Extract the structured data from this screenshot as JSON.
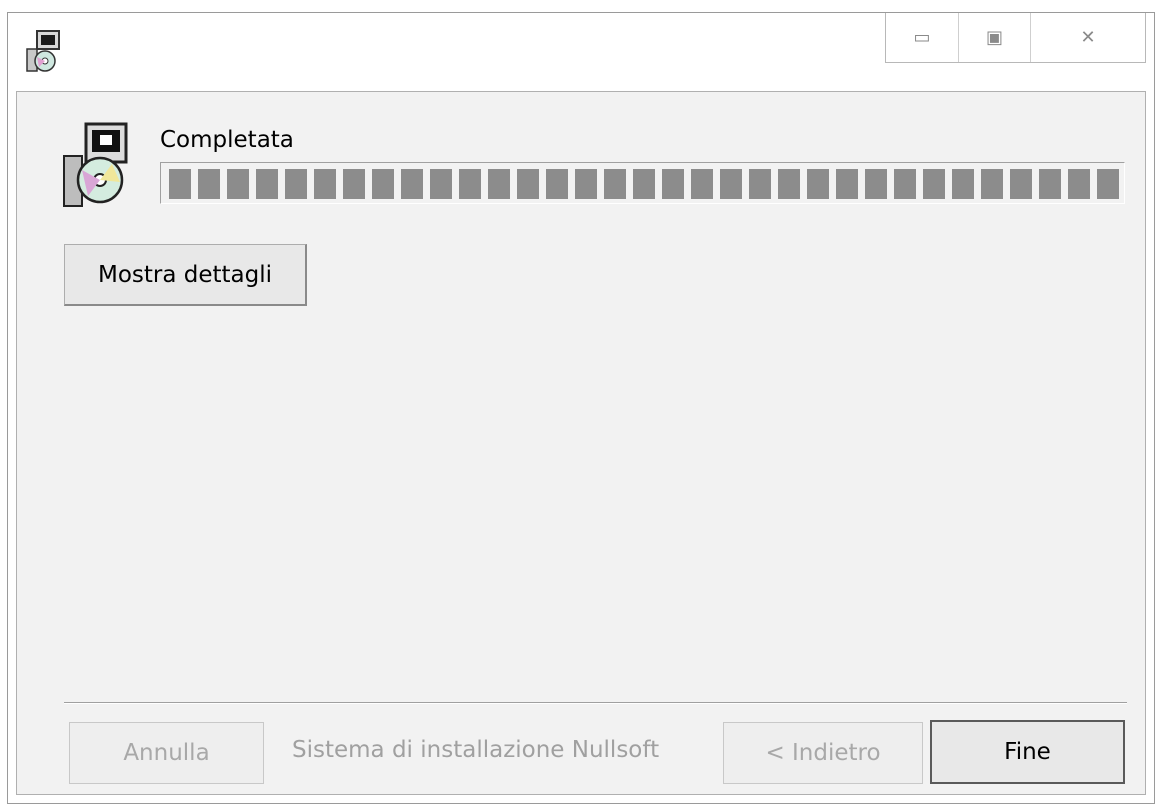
{
  "titlebar": {
    "icon": "installer-icon",
    "buttons": [
      {
        "name": "minimize",
        "glyph": "▭"
      },
      {
        "name": "maximize",
        "glyph": "▣"
      },
      {
        "name": "close",
        "glyph": "✕"
      }
    ]
  },
  "status": {
    "label": "Completata",
    "progress_fraction": 1.0
  },
  "details_button": {
    "label": "Mostra dettagli"
  },
  "footer": {
    "cancel_label": "Annulla",
    "branding": "Sistema di installazione Nullsoft",
    "back_label": "< Indietro",
    "finish_label": "Fine"
  },
  "colors": {
    "client_bg": "#f2f2f2",
    "progress_fill": "#8c8c8c",
    "disabled_text": "#a8a8a8"
  }
}
